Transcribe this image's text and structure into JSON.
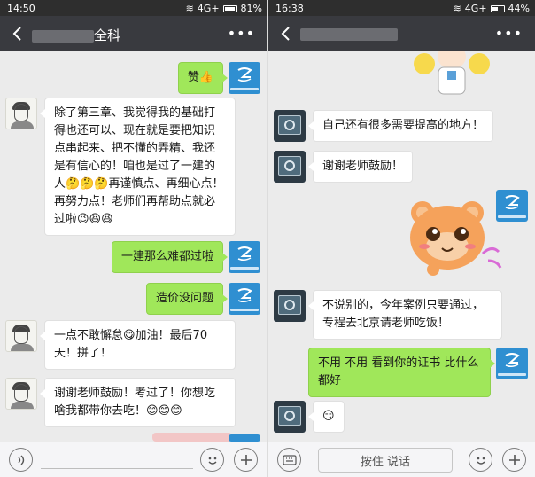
{
  "left": {
    "status": {
      "time": "14:50",
      "network": "4G+",
      "battery": "81%",
      "battery_level": 0.81
    },
    "title": {
      "suffix": "全科"
    },
    "messages": [
      {
        "dir": "out",
        "text": "赞👍"
      },
      {
        "dir": "in",
        "text": "除了第三章、我觉得我的基础打得也还可以、现在就是要把知识点串起来、把不懂的弄精、我还是有信心的！咱也是过了一建的人🤔🤔🤔再谨慎点、再细心点！再努力点！老师们再帮助点就必过啦😉😆😆"
      },
      {
        "dir": "out",
        "text": "一建那么难都过啦"
      },
      {
        "dir": "out",
        "text": "造价没问题"
      },
      {
        "dir": "in",
        "text": "一点不敢懈怠😋加油！最后70天！拼了！"
      },
      {
        "dir": "in",
        "text": "谢谢老师鼓励！考过了！你想吃啥我都带你去吃！😊😊😊"
      }
    ]
  },
  "right": {
    "status": {
      "time": "16:38",
      "network": "4G+",
      "battery": "44%",
      "battery_level": 0.44
    },
    "messages": [
      {
        "dir": "in",
        "text": "自己还有很多需要提高的地方！"
      },
      {
        "dir": "in",
        "text": "谢谢老师鼓励！"
      },
      {
        "dir": "in",
        "text": "不说别的，今年案例只要通过，专程去北京请老师吃饭！"
      },
      {
        "dir": "out",
        "text": "不用 不用  看到你的证书  比什么都好"
      },
      {
        "dir": "in",
        "text": "😏"
      }
    ],
    "hold_to_talk": "按住 说话"
  },
  "colors": {
    "titlebar": "#393a3f",
    "chat_bg": "#ebebeb",
    "bubble_out": "#a0e75a",
    "bubble_in": "#ffffff",
    "logo": "#2f8fd1"
  },
  "icons": {
    "back": "chevron-left-icon",
    "more": "more-dots-icon",
    "voice": "voice-icon",
    "emoji": "emoji-icon",
    "plus": "plus-icon",
    "keyboard": "keyboard-icon"
  }
}
